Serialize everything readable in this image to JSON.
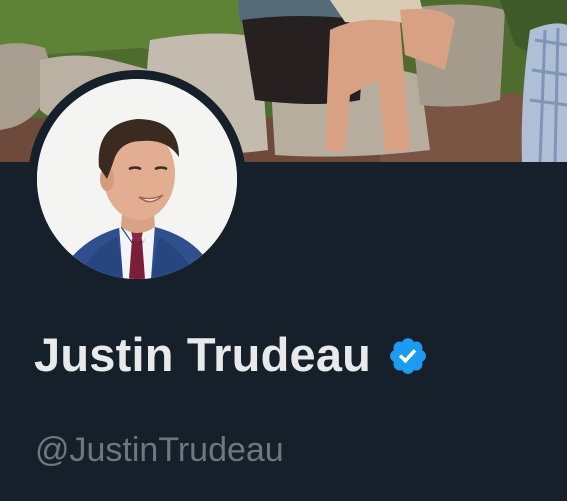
{
  "profile": {
    "display_name": "Justin Trudeau",
    "handle": "@JustinTrudeau",
    "verified": true,
    "banner_description": "header-photo",
    "avatar_description": "profile-photo"
  },
  "icons": {
    "verified": "verified-badge-icon"
  },
  "colors": {
    "background": "#15202b",
    "name_text": "#e7e9ea",
    "handle_text": "#71767b",
    "verified_blue": "#1d9bf0"
  }
}
